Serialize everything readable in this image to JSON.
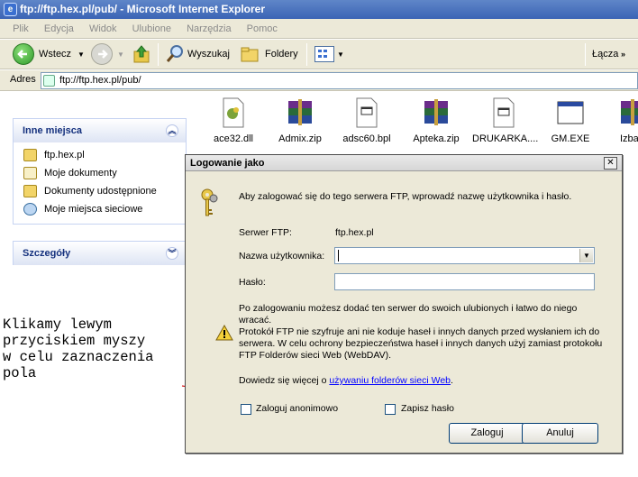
{
  "window": {
    "title": "ftp://ftp.hex.pl/pub/ - Microsoft Internet Explorer"
  },
  "menu": [
    "Plik",
    "Edycja",
    "Widok",
    "Ulubione",
    "Narzędzia",
    "Pomoc"
  ],
  "toolbar": {
    "back_label": "Wstecz",
    "search_label": "Wyszukaj",
    "folders_label": "Foldery",
    "links_label": "Łącza"
  },
  "address": {
    "label": "Adres",
    "value": "ftp://ftp.hex.pl/pub/"
  },
  "sidebar": {
    "other_places": {
      "title": "Inne miejsca",
      "items": [
        {
          "label": "ftp.hex.pl",
          "icon": "ftp-folder-icon"
        },
        {
          "label": "Moje dokumenty",
          "icon": "documents-folder-icon"
        },
        {
          "label": "Dokumenty udostępnione",
          "icon": "shared-folder-icon"
        },
        {
          "label": "Moje miejsca sieciowe",
          "icon": "network-places-icon"
        }
      ]
    },
    "details": {
      "title": "Szczegóły"
    }
  },
  "files": [
    {
      "name": "ace32.dll",
      "icon": "dll-file-icon"
    },
    {
      "name": "Admix.zip",
      "icon": "zip-archive-icon"
    },
    {
      "name": "adsc60.bpl",
      "icon": "bpl-file-icon"
    },
    {
      "name": "Apteka.zip",
      "icon": "zip-archive-icon"
    },
    {
      "name": "DRUKARKA....",
      "icon": "generic-file-icon"
    },
    {
      "name": "GM.EXE",
      "icon": "exe-file-icon"
    },
    {
      "name": "Izba",
      "icon": "zip-archive-icon"
    }
  ],
  "annotation": {
    "text": "Klikamy lewym\nprzyciskiem myszy\nw celu zaznaczenia\npola"
  },
  "dialog": {
    "title": "Logowanie jako",
    "intro": "Aby zalogować się do tego serwera FTP, wprowadź nazwę użytkownika i hasło.",
    "server_label": "Serwer FTP:",
    "server_value": "ftp.hex.pl",
    "username_label": "Nazwa użytkownika:",
    "username_value": "",
    "password_label": "Hasło:",
    "password_value": "",
    "after_login_note": "Po zalogowaniu możesz dodać ten serwer do swoich ulubionych i łatwo do niego wracać.",
    "warning": "Protokół FTP nie szyfruje ani nie koduje haseł i innych danych przed wysłaniem ich do serwera. W celu ochrony bezpieczeństwa haseł i innych danych użyj zamiast protokołu FTP Folderów sieci Web (WebDAV).",
    "learn_more_prefix": "Dowiedz się więcej o ",
    "learn_more_link": "używaniu folderów sieci Web",
    "learn_more_suffix": ".",
    "anonymous_label": "Zaloguj anonimowo",
    "anonymous_checked": false,
    "save_password_label": "Zapisz hasło",
    "save_password_checked": false,
    "login_button": "Zaloguj",
    "cancel_button": "Anuluj"
  },
  "colors": {
    "annotation": "#d82020",
    "link": "#0000ff",
    "panel_header": "#15317e"
  }
}
